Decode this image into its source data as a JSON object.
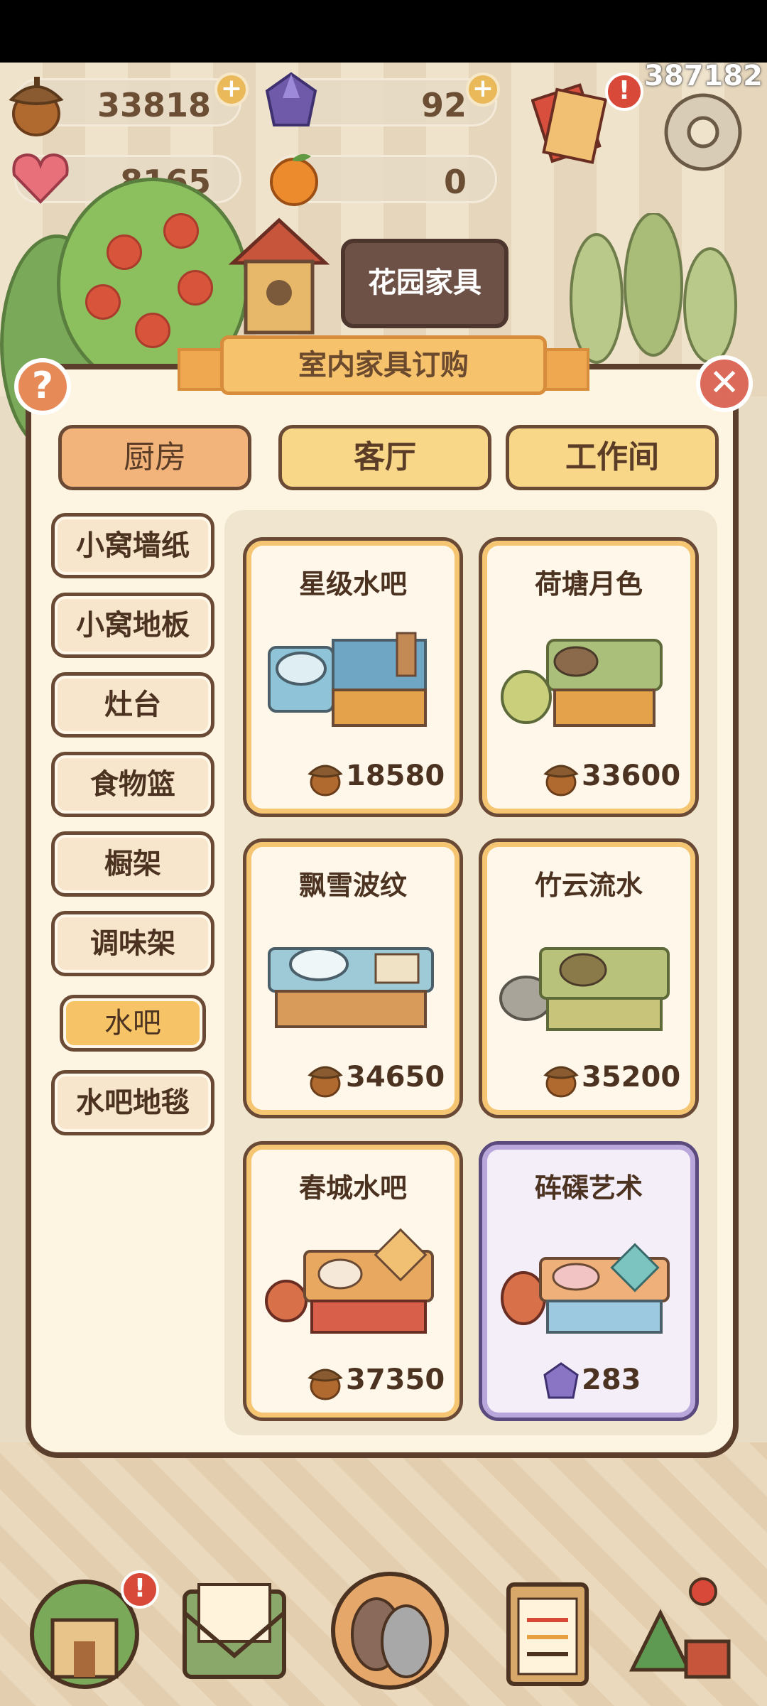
{
  "top_id": "387182",
  "resources": {
    "acorns": "33818",
    "gems": "92",
    "hearts": "8165",
    "oranges": "0",
    "plus": "+"
  },
  "scene_sign": "花园家具",
  "dialog": {
    "title": "室内家具订购",
    "help": "?",
    "close": "✕"
  },
  "tabs": [
    "厨房",
    "客厅",
    "工作间"
  ],
  "categories": [
    "小窝墙纸",
    "小窝地板",
    "灶台",
    "食物篮",
    "橱架",
    "调味架",
    "水吧",
    "水吧地毯"
  ],
  "items": [
    {
      "name": "星级水吧",
      "price": "18580",
      "currency": "acorn"
    },
    {
      "name": "荷塘月色",
      "price": "33600",
      "currency": "acorn"
    },
    {
      "name": "飘雪波纹",
      "price": "34650",
      "currency": "acorn"
    },
    {
      "name": "竹云流水",
      "price": "35200",
      "currency": "acorn"
    },
    {
      "name": "春城水吧",
      "price": "37350",
      "currency": "acorn"
    },
    {
      "name": "砗磲艺术",
      "price": "283",
      "currency": "gem"
    }
  ],
  "nav_badge": "!",
  "colors": {
    "accent": "#f6c26c",
    "border": "#6a4a35",
    "special": "#b9a7dc"
  }
}
